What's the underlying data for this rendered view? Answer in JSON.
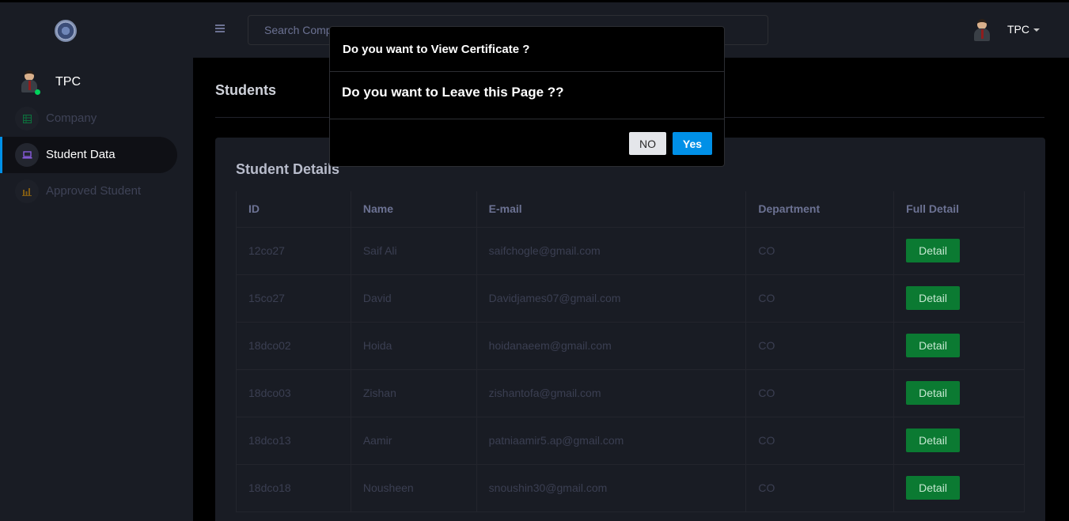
{
  "sidebar": {
    "profile_name": "TPC",
    "items": [
      {
        "label": "Company",
        "icon": "table-icon",
        "color": "#00d25b"
      },
      {
        "label": "Student Data",
        "icon": "laptop-icon",
        "color": "#8f5fe8"
      },
      {
        "label": "Approved Student",
        "icon": "bar-chart-icon",
        "color": "#ffab00"
      }
    ]
  },
  "topbar": {
    "search_placeholder": "Search Company",
    "user_name": "TPC"
  },
  "main": {
    "page_title": "Students",
    "card_title": "Student Details",
    "columns": [
      "ID",
      "Name",
      "E-mail",
      "Department",
      "Full Detail"
    ],
    "rows": [
      {
        "id": "12co27",
        "name": "Saif Ali",
        "email": "saifchogle@gmail.com",
        "dept": "CO",
        "action": "Detail"
      },
      {
        "id": "15co27",
        "name": "David",
        "email": "Davidjames07@gmail.com",
        "dept": "CO",
        "action": "Detail"
      },
      {
        "id": "18dco02",
        "name": "Hoida",
        "email": "hoidanaeem@gmail.com",
        "dept": "CO",
        "action": "Detail"
      },
      {
        "id": "18dco03",
        "name": "Zishan",
        "email": "zishantofa@gmail.com",
        "dept": "CO",
        "action": "Detail"
      },
      {
        "id": "18dco13",
        "name": "Aamir",
        "email": "patniaamir5.ap@gmail.com",
        "dept": "CO",
        "action": "Detail"
      },
      {
        "id": "18dco18",
        "name": "Nousheen",
        "email": "snoushin30@gmail.com",
        "dept": "CO",
        "action": "Detail"
      }
    ]
  },
  "modal": {
    "title": "Do you want to View Certificate ?",
    "body": "Do you want to Leave this Page ??",
    "no_label": "NO",
    "yes_label": "Yes"
  },
  "colors": {
    "accent": "#0090e7",
    "success": "#0b7a32",
    "sidebar_bg": "#191c24"
  }
}
